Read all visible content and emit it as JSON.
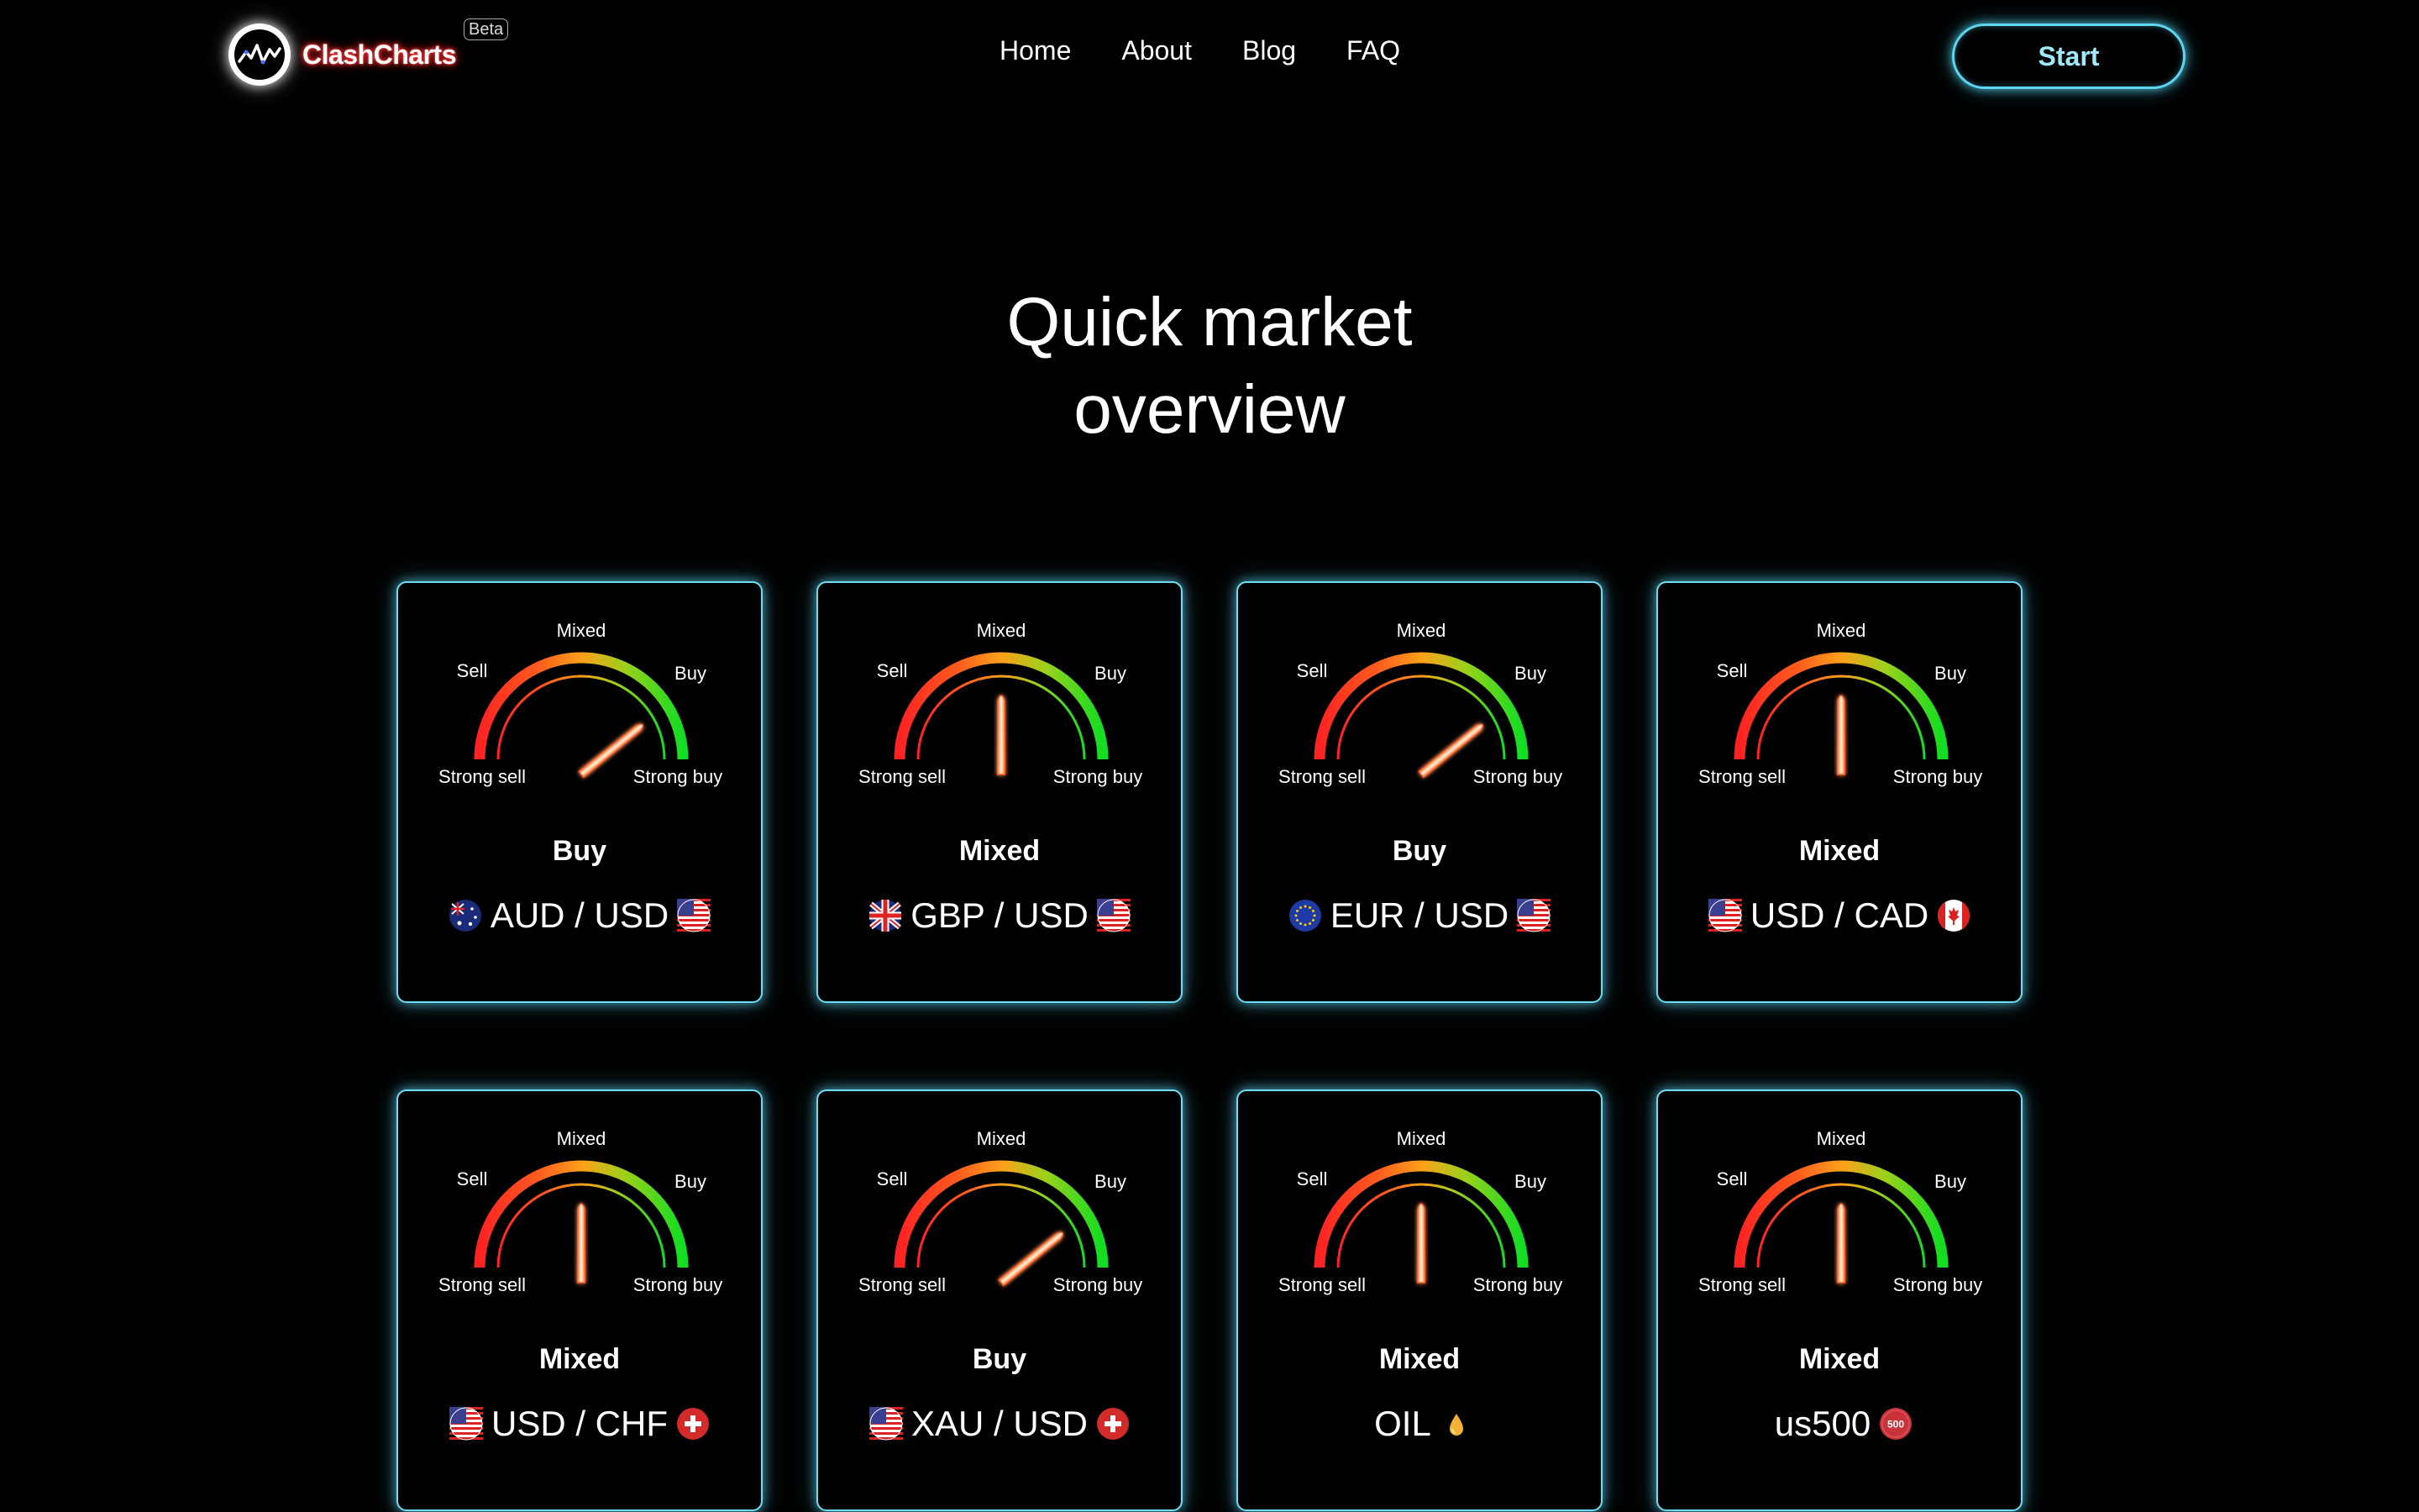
{
  "brand": {
    "name": "ClashCharts",
    "badge": "Beta",
    "logo_icon": "wave-chart-icon"
  },
  "nav": {
    "links": [
      "Home",
      "About",
      "Blog",
      "FAQ"
    ],
    "cta": "Start"
  },
  "heading": {
    "line1": "Quick market",
    "line2": "overview"
  },
  "gauge_labels": {
    "sell": "Sell",
    "mixed": "Mixed",
    "buy": "Buy",
    "strong_sell": "Strong sell",
    "strong_buy": "Strong buy"
  },
  "colors": {
    "card_border": "#6fdcf2",
    "brand_glow": "#ff2020",
    "gauge_red": "#ff2222",
    "gauge_orange": "#ff9a1a",
    "gauge_green": "#11dd22"
  },
  "cards": [
    {
      "signal": "Buy",
      "pair": "AUD / USD",
      "left_icon": "australia-flag-icon",
      "right_icon": "usa-flag-icon",
      "needle": "buy"
    },
    {
      "signal": "Mixed",
      "pair": "GBP / USD",
      "left_icon": "uk-flag-icon",
      "right_icon": "usa-flag-icon",
      "needle": "mixed"
    },
    {
      "signal": "Buy",
      "pair": "EUR / USD",
      "left_icon": "eu-flag-icon",
      "right_icon": "usa-flag-icon",
      "needle": "buy"
    },
    {
      "signal": "Mixed",
      "pair": "USD / CAD",
      "left_icon": "usa-flag-icon",
      "right_icon": "canada-flag-icon",
      "needle": "mixed"
    },
    {
      "signal": "Mixed",
      "pair": "USD / CHF",
      "left_icon": "usa-flag-icon",
      "right_icon": "swiss-flag-icon",
      "needle": "mixed"
    },
    {
      "signal": "Buy",
      "pair": "XAU / USD",
      "left_icon": "usa-flag-icon",
      "right_icon": "swiss-flag-icon",
      "needle": "buy"
    },
    {
      "signal": "Mixed",
      "pair": "OIL",
      "left_icon": "",
      "right_icon": "oil-drop-icon",
      "needle": "mixed"
    },
    {
      "signal": "Mixed",
      "pair": "us500",
      "left_icon": "",
      "right_icon": "us500-badge-icon",
      "needle": "mixed",
      "badge_text": "500"
    }
  ]
}
